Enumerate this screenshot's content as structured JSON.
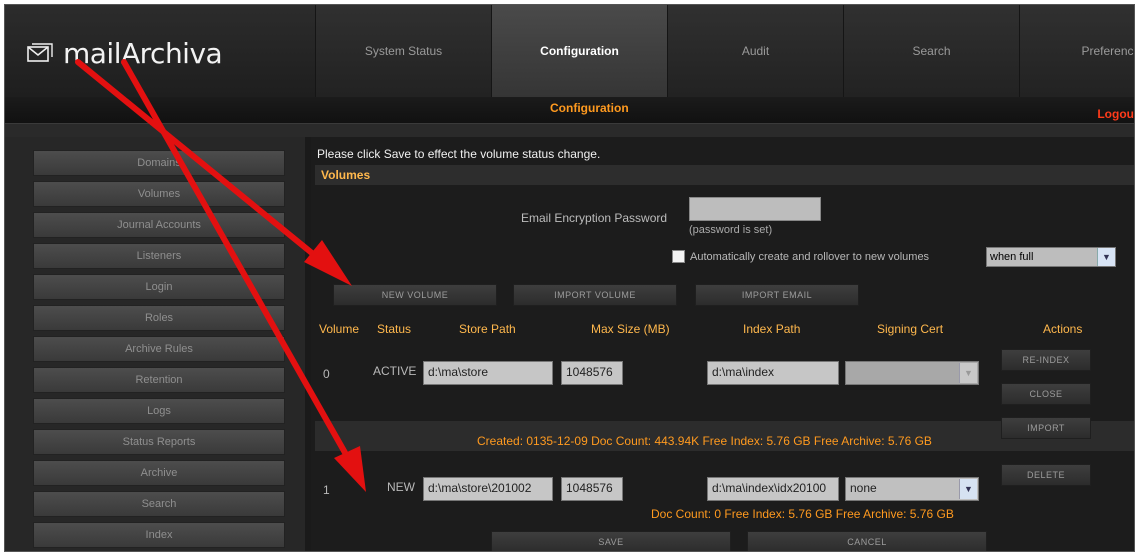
{
  "app": {
    "brand": "mailArchiva",
    "logout": "Logout"
  },
  "topnav": [
    {
      "label": "System Status",
      "active": false
    },
    {
      "label": "Configuration",
      "active": true
    },
    {
      "label": "Audit",
      "active": false
    },
    {
      "label": "Search",
      "active": false
    },
    {
      "label": "Preferenc",
      "active": false
    }
  ],
  "subheader": {
    "title": "Configuration"
  },
  "sidebar": {
    "items": [
      {
        "label": "Domains"
      },
      {
        "label": "Volumes"
      },
      {
        "label": "Journal Accounts"
      },
      {
        "label": "Listeners"
      },
      {
        "label": "Login"
      },
      {
        "label": "Roles"
      },
      {
        "label": "Archive Rules"
      },
      {
        "label": "Retention"
      },
      {
        "label": "Logs"
      },
      {
        "label": "Status Reports"
      },
      {
        "label": "Archive"
      },
      {
        "label": "Search"
      },
      {
        "label": "Index"
      }
    ]
  },
  "main": {
    "notice": "Please click Save to effect the volume status change.",
    "section_title": "Volumes",
    "encryption": {
      "label": "Email Encryption Password",
      "value": "",
      "hint": "(password is set)"
    },
    "auto_rollover": {
      "checked": false,
      "label": "Automatically create and rollover to new volumes",
      "selected": "when full"
    },
    "buttons": {
      "new_volume": "NEW VOLUME",
      "import_volume": "IMPORT VOLUME",
      "import_email": "IMPORT EMAIL",
      "save": "SAVE",
      "cancel": "CANCEL"
    },
    "columns": [
      "Volume",
      "Status",
      "Store Path",
      "Max Size (MB)",
      "Index Path",
      "Signing Cert",
      "Actions"
    ],
    "volumes": [
      {
        "id": "0",
        "status": "ACTIVE",
        "store_path": "d:\\ma\\store",
        "max_size": "1048576",
        "index_path": "d:\\ma\\index",
        "signing_cert": "",
        "actions": [
          "RE-INDEX",
          "CLOSE",
          "IMPORT"
        ],
        "summary": "Created: 0135-12-09  Doc Count: 443.94K  Free Index: 5.76 GB  Free Archive: 5.76 GB"
      },
      {
        "id": "1",
        "status": "NEW",
        "store_path": "d:\\ma\\store\\201002",
        "max_size": "1048576",
        "index_path": "d:\\ma\\index\\idx20100",
        "signing_cert": "none",
        "actions": [
          "DELETE"
        ],
        "summary": "Doc Count: 0  Free Index: 5.76 GB  Free Archive: 5.76 GB"
      }
    ]
  },
  "colors": {
    "accent_orange": "#ff9a1f",
    "logout_red": "#ff3b1a",
    "annotation_arrow": "#e31010"
  }
}
